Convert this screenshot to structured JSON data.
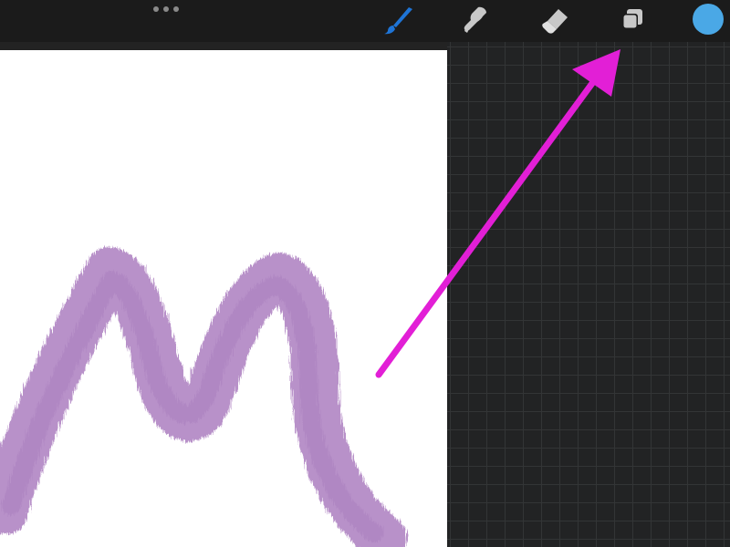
{
  "toolbar": {
    "more_icon": "more-dots-icon",
    "tools": [
      {
        "name": "brush",
        "icon": "brush-icon",
        "active": true
      },
      {
        "name": "smudge",
        "icon": "smudge-icon",
        "active": false
      },
      {
        "name": "eraser",
        "icon": "eraser-icon",
        "active": false
      },
      {
        "name": "layers",
        "icon": "layers-icon",
        "active": false
      }
    ],
    "current_color": "#4aa8e6"
  },
  "canvas": {
    "background": "#ffffff",
    "stroke_color": "#b288c4"
  },
  "annotation": {
    "arrow_color": "#e21fd6",
    "points_to": "layers-icon"
  },
  "colors": {
    "active_tool": "#1e74d6",
    "inactive_tool": "#c8c8c8",
    "toolbar_bg": "#1b1b1b",
    "grid_bg": "#222324"
  }
}
